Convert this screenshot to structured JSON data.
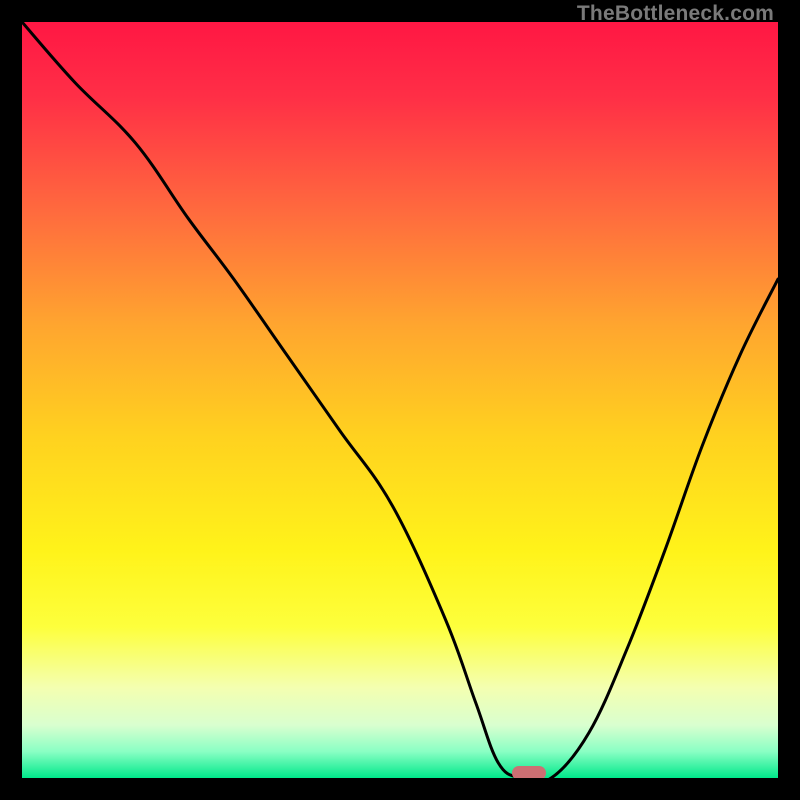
{
  "watermark": "TheBottleneck.com",
  "gradient": {
    "stops": [
      {
        "offset": 0.0,
        "color": "#ff1744"
      },
      {
        "offset": 0.1,
        "color": "#ff2f46"
      },
      {
        "offset": 0.25,
        "color": "#ff6a3e"
      },
      {
        "offset": 0.4,
        "color": "#ffa52f"
      },
      {
        "offset": 0.55,
        "color": "#ffd21f"
      },
      {
        "offset": 0.7,
        "color": "#fff31a"
      },
      {
        "offset": 0.8,
        "color": "#fdff3c"
      },
      {
        "offset": 0.88,
        "color": "#f4ffb0"
      },
      {
        "offset": 0.93,
        "color": "#d9ffcf"
      },
      {
        "offset": 0.965,
        "color": "#8affc4"
      },
      {
        "offset": 1.0,
        "color": "#00e88a"
      }
    ]
  },
  "chart_data": {
    "type": "line",
    "title": "",
    "xlabel": "",
    "ylabel": "",
    "xlim": [
      0,
      100
    ],
    "ylim": [
      0,
      100
    ],
    "series": [
      {
        "name": "bottleneck-curve",
        "x": [
          0,
          7,
          15,
          22,
          28,
          35,
          42,
          49,
          56,
          60,
          63,
          66,
          70,
          75,
          80,
          85,
          90,
          95,
          100
        ],
        "values": [
          100,
          92,
          84,
          74,
          66,
          56,
          46,
          36,
          21,
          10,
          2,
          0,
          0,
          6,
          17,
          30,
          44,
          56,
          66
        ]
      }
    ],
    "annotations": [
      {
        "name": "bottleneck-marker",
        "x": 67,
        "y": 0
      }
    ]
  }
}
